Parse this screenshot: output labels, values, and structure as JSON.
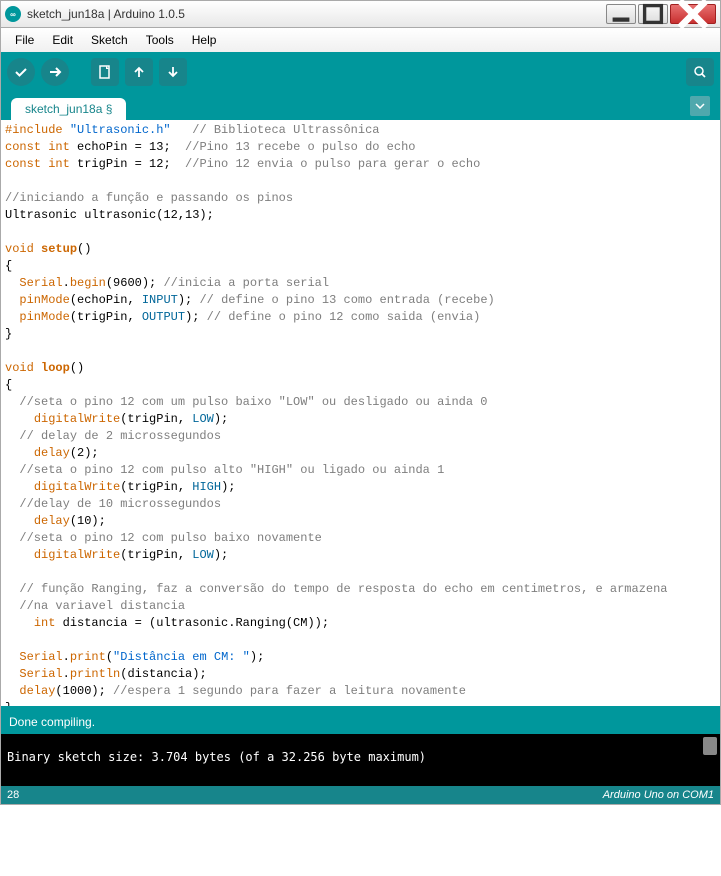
{
  "window": {
    "title": "sketch_jun18a | Arduino 1.0.5",
    "icon_label": "∞"
  },
  "menu": {
    "items": [
      "File",
      "Edit",
      "Sketch",
      "Tools",
      "Help"
    ]
  },
  "toolbar": {
    "verify": "Verify",
    "upload": "Upload",
    "new": "New",
    "open": "Open",
    "save": "Save",
    "serial": "Serial Monitor"
  },
  "tabs": {
    "active": "sketch_jun18a §"
  },
  "code": {
    "lines": [
      {
        "t": [
          {
            "c": "kw-red",
            "s": "#include "
          },
          {
            "c": "str",
            "s": "\"Ultrasonic.h\""
          },
          {
            "c": "",
            "s": "   "
          },
          {
            "c": "com",
            "s": "// Biblioteca Ultrassônica"
          }
        ]
      },
      {
        "t": [
          {
            "c": "kw-red",
            "s": "const"
          },
          {
            "c": "",
            "s": " "
          },
          {
            "c": "kw-red",
            "s": "int"
          },
          {
            "c": "",
            "s": " echoPin = 13;  "
          },
          {
            "c": "com",
            "s": "//Pino 13 recebe o pulso do echo"
          }
        ]
      },
      {
        "t": [
          {
            "c": "kw-red",
            "s": "const"
          },
          {
            "c": "",
            "s": " "
          },
          {
            "c": "kw-red",
            "s": "int"
          },
          {
            "c": "",
            "s": " trigPin = 12;  "
          },
          {
            "c": "com",
            "s": "//Pino 12 envia o pulso para gerar o echo"
          }
        ]
      },
      {
        "t": [
          {
            "c": "",
            "s": " "
          }
        ]
      },
      {
        "t": [
          {
            "c": "com",
            "s": "//iniciando a função e passando os pinos"
          }
        ]
      },
      {
        "t": [
          {
            "c": "",
            "s": "Ultrasonic ultrasonic(12,13);"
          }
        ]
      },
      {
        "t": [
          {
            "c": "",
            "s": " "
          }
        ]
      },
      {
        "t": [
          {
            "c": "kw-red",
            "s": "void"
          },
          {
            "c": "",
            "s": " "
          },
          {
            "c": "func",
            "s": "setup"
          },
          {
            "c": "",
            "s": "()"
          }
        ]
      },
      {
        "t": [
          {
            "c": "",
            "s": "{"
          }
        ]
      },
      {
        "t": [
          {
            "c": "",
            "s": "  "
          },
          {
            "c": "orange",
            "s": "Serial"
          },
          {
            "c": "",
            "s": "."
          },
          {
            "c": "orange",
            "s": "begin"
          },
          {
            "c": "",
            "s": "(9600); "
          },
          {
            "c": "com",
            "s": "//inicia a porta serial"
          }
        ]
      },
      {
        "t": [
          {
            "c": "",
            "s": "  "
          },
          {
            "c": "orange",
            "s": "pinMode"
          },
          {
            "c": "",
            "s": "(echoPin, "
          },
          {
            "c": "kw-teal",
            "s": "INPUT"
          },
          {
            "c": "",
            "s": "); "
          },
          {
            "c": "com",
            "s": "// define o pino 13 como entrada (recebe)"
          }
        ]
      },
      {
        "t": [
          {
            "c": "",
            "s": "  "
          },
          {
            "c": "orange",
            "s": "pinMode"
          },
          {
            "c": "",
            "s": "(trigPin, "
          },
          {
            "c": "kw-teal",
            "s": "OUTPUT"
          },
          {
            "c": "",
            "s": "); "
          },
          {
            "c": "com",
            "s": "// define o pino 12 como saida (envia)"
          }
        ]
      },
      {
        "t": [
          {
            "c": "",
            "s": "}"
          }
        ]
      },
      {
        "t": [
          {
            "c": "",
            "s": " "
          }
        ]
      },
      {
        "t": [
          {
            "c": "kw-red",
            "s": "void"
          },
          {
            "c": "",
            "s": " "
          },
          {
            "c": "func",
            "s": "loop"
          },
          {
            "c": "",
            "s": "()"
          }
        ]
      },
      {
        "t": [
          {
            "c": "",
            "s": "{"
          }
        ]
      },
      {
        "t": [
          {
            "c": "",
            "s": "  "
          },
          {
            "c": "com",
            "s": "//seta o pino 12 com um pulso baixo \"LOW\" ou desligado ou ainda 0"
          }
        ]
      },
      {
        "t": [
          {
            "c": "",
            "s": "    "
          },
          {
            "c": "orange",
            "s": "digitalWrite"
          },
          {
            "c": "",
            "s": "(trigPin, "
          },
          {
            "c": "kw-teal",
            "s": "LOW"
          },
          {
            "c": "",
            "s": ");"
          }
        ]
      },
      {
        "t": [
          {
            "c": "",
            "s": "  "
          },
          {
            "c": "com",
            "s": "// delay de 2 microssegundos"
          }
        ]
      },
      {
        "t": [
          {
            "c": "",
            "s": "    "
          },
          {
            "c": "orange",
            "s": "delay"
          },
          {
            "c": "",
            "s": "(2);"
          }
        ]
      },
      {
        "t": [
          {
            "c": "",
            "s": "  "
          },
          {
            "c": "com",
            "s": "//seta o pino 12 com pulso alto \"HIGH\" ou ligado ou ainda 1"
          }
        ]
      },
      {
        "t": [
          {
            "c": "",
            "s": "    "
          },
          {
            "c": "orange",
            "s": "digitalWrite"
          },
          {
            "c": "",
            "s": "(trigPin, "
          },
          {
            "c": "kw-teal",
            "s": "HIGH"
          },
          {
            "c": "",
            "s": ");"
          }
        ]
      },
      {
        "t": [
          {
            "c": "",
            "s": "  "
          },
          {
            "c": "com",
            "s": "//delay de 10 microssegundos"
          }
        ]
      },
      {
        "t": [
          {
            "c": "",
            "s": "    "
          },
          {
            "c": "orange",
            "s": "delay"
          },
          {
            "c": "",
            "s": "(10);"
          }
        ]
      },
      {
        "t": [
          {
            "c": "",
            "s": "  "
          },
          {
            "c": "com",
            "s": "//seta o pino 12 com pulso baixo novamente"
          }
        ]
      },
      {
        "t": [
          {
            "c": "",
            "s": "    "
          },
          {
            "c": "orange",
            "s": "digitalWrite"
          },
          {
            "c": "",
            "s": "(trigPin, "
          },
          {
            "c": "kw-teal",
            "s": "LOW"
          },
          {
            "c": "",
            "s": ");"
          }
        ]
      },
      {
        "t": [
          {
            "c": "",
            "s": " "
          }
        ]
      },
      {
        "t": [
          {
            "c": "",
            "s": "  "
          },
          {
            "c": "com",
            "s": "// função Ranging, faz a conversão do tempo de resposta do echo em centimetros, e armazena"
          }
        ]
      },
      {
        "t": [
          {
            "c": "",
            "s": "  "
          },
          {
            "c": "com",
            "s": "//na variavel distancia"
          }
        ]
      },
      {
        "t": [
          {
            "c": "",
            "s": "    "
          },
          {
            "c": "kw-red",
            "s": "int"
          },
          {
            "c": "",
            "s": " distancia = (ultrasonic.Ranging(CM));"
          }
        ]
      },
      {
        "t": [
          {
            "c": "",
            "s": " "
          }
        ]
      },
      {
        "t": [
          {
            "c": "",
            "s": "  "
          },
          {
            "c": "orange",
            "s": "Serial"
          },
          {
            "c": "",
            "s": "."
          },
          {
            "c": "orange",
            "s": "print"
          },
          {
            "c": "",
            "s": "("
          },
          {
            "c": "str",
            "s": "\"Distância em CM: \""
          },
          {
            "c": "",
            "s": ");"
          }
        ]
      },
      {
        "t": [
          {
            "c": "",
            "s": "  "
          },
          {
            "c": "orange",
            "s": "Serial"
          },
          {
            "c": "",
            "s": "."
          },
          {
            "c": "orange",
            "s": "println"
          },
          {
            "c": "",
            "s": "(distancia);"
          }
        ]
      },
      {
        "t": [
          {
            "c": "",
            "s": "  "
          },
          {
            "c": "orange",
            "s": "delay"
          },
          {
            "c": "",
            "s": "(1000); "
          },
          {
            "c": "com",
            "s": "//espera 1 segundo para fazer a leitura novamente"
          }
        ]
      },
      {
        "t": [
          {
            "c": "",
            "s": "}"
          }
        ]
      }
    ]
  },
  "status": {
    "message": "Done compiling."
  },
  "console": {
    "text": "Binary sketch size: 3.704 bytes (of a 32.256 byte maximum)"
  },
  "footer": {
    "line": "28",
    "board": "Arduino Uno on COM1"
  }
}
